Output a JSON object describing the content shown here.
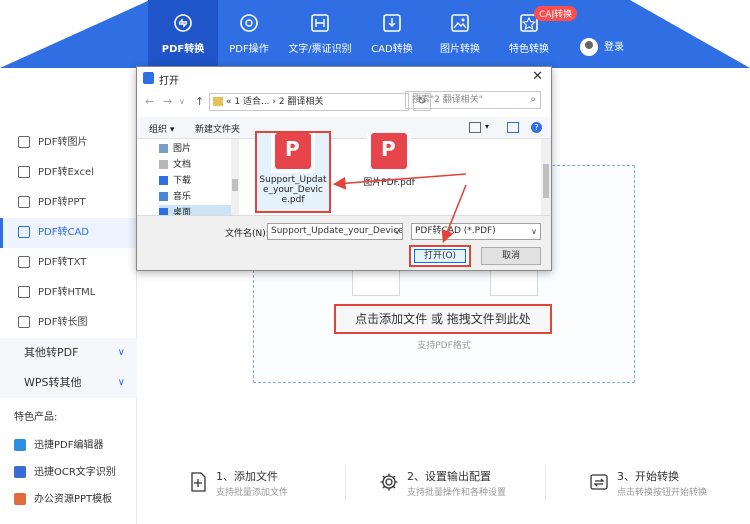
{
  "nav": {
    "items": [
      {
        "label": "PDF转换",
        "icon": "pdf-convert-icon",
        "active": true
      },
      {
        "label": "PDF操作",
        "icon": "pdf-operate-icon"
      },
      {
        "label": "文字/票证识别",
        "icon": "text-recognition-icon"
      },
      {
        "label": "CAD转换",
        "icon": "cad-convert-icon"
      },
      {
        "label": "图片转换",
        "icon": "image-convert-icon"
      },
      {
        "label": "特色转换",
        "icon": "special-convert-icon"
      }
    ],
    "badge": "CAJ转换",
    "login": "登录"
  },
  "sidebar": {
    "items": [
      {
        "label": "PDF转图片"
      },
      {
        "label": "PDF转Excel"
      },
      {
        "label": "PDF转PPT"
      },
      {
        "label": "PDF转CAD",
        "active": true
      },
      {
        "label": "PDF转TXT"
      },
      {
        "label": "PDF转HTML"
      },
      {
        "label": "PDF转长图"
      }
    ],
    "groups": [
      {
        "label": "其他转PDF"
      },
      {
        "label": "WPS转其他"
      }
    ],
    "featured_heading": "特色产品:",
    "products": [
      {
        "label": "迅捷PDF编辑器"
      },
      {
        "label": "迅捷OCR文字识别"
      },
      {
        "label": "办公资源PPT模板"
      }
    ]
  },
  "main": {
    "add_button": "点击添加文件 或 拖拽文件到此处",
    "support_text": "支持PDF格式",
    "steps": [
      {
        "title": "1、添加文件",
        "desc": "支持批量添加文件"
      },
      {
        "title": "2、设置输出配置",
        "desc": "支持批量操作和各种设置"
      },
      {
        "title": "3、开始转换",
        "desc": "点击转换按钮开始转换"
      }
    ]
  },
  "dialog": {
    "title": "打开",
    "breadcrumb": "« 1 适合... › 2 翻译相关",
    "search_placeholder": "搜索\"2 翻译相关\"",
    "organize": "组织 ▾",
    "new_folder": "新建文件夹",
    "tree": [
      {
        "label": "图片"
      },
      {
        "label": "文档"
      },
      {
        "label": "下载"
      },
      {
        "label": "音乐"
      },
      {
        "label": "桌面"
      }
    ],
    "files": [
      {
        "name": "Support_Update_your_Device.pdf",
        "selected": true
      },
      {
        "name": "图片PDF.pdf"
      }
    ],
    "filename_label": "文件名(N):",
    "filename_value": "Support_Update_your_Device.pdf",
    "filetype": "PDF转CAD (*.PDF)",
    "open_button": "打开(O)",
    "cancel_button": "取消"
  },
  "colors": {
    "brand": "#2f6fe3",
    "highlight": "#e0443a"
  }
}
